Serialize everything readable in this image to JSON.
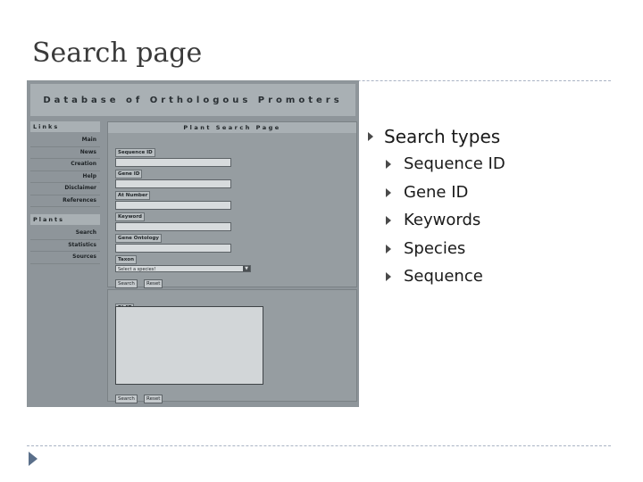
{
  "slide": {
    "title": "Search page"
  },
  "screenshot": {
    "banner": "Database of Orthologous Promoters",
    "sidebar": {
      "links_heading": "Links",
      "links": [
        "Main",
        "News",
        "Creation",
        "Help",
        "Disclaimer",
        "References"
      ],
      "plants_heading": "Plants",
      "plants": [
        "Search",
        "Statistics",
        "Sources"
      ]
    },
    "search_panel": {
      "heading": "Plant Search Page",
      "fields": [
        "Sequence ID",
        "Gene ID",
        "At Number",
        "Keyword",
        "Gene Ontology"
      ],
      "taxon_label": "Taxon",
      "taxon_select": "Select a species!",
      "search_btn": "Search",
      "reset_btn": "Reset"
    },
    "blat_panel": {
      "label": "BLAT",
      "search_btn": "Search",
      "reset_btn": "Reset"
    }
  },
  "bullets": {
    "main": "Search types",
    "items": [
      "Sequence ID",
      "Gene ID",
      "Keywords",
      "Species",
      "Sequence"
    ]
  }
}
